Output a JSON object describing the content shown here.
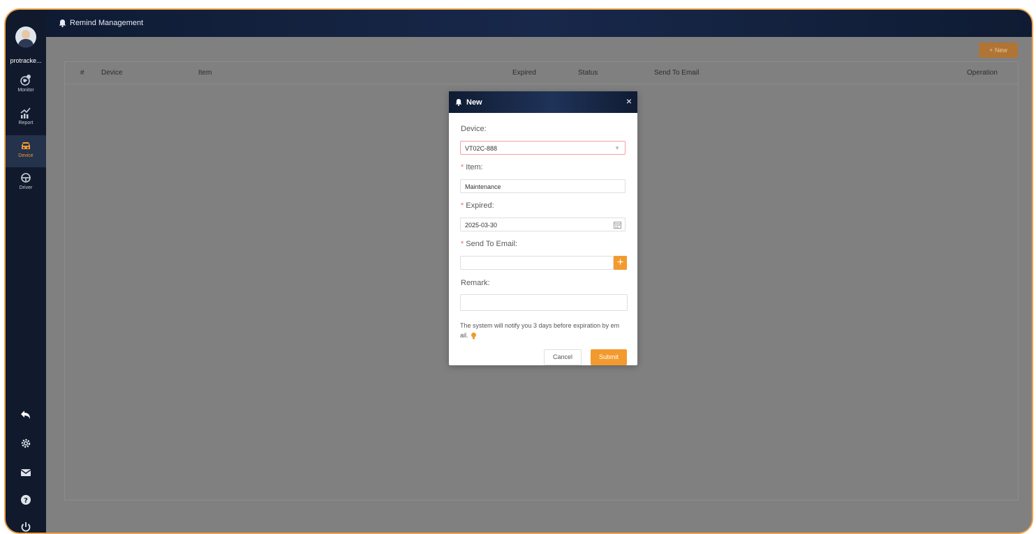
{
  "app": {
    "accent_color": "#f39a2e",
    "sidebar_color": "#101a2c"
  },
  "user": {
    "name": "protracke..."
  },
  "sidebar": {
    "items": [
      {
        "label": "Monitor",
        "icon": "globe-location-icon",
        "active": false
      },
      {
        "label": "Report",
        "icon": "chart-icon",
        "active": false
      },
      {
        "label": "Device",
        "icon": "car-icon",
        "active": true
      },
      {
        "label": "Driver",
        "icon": "steering-wheel-icon",
        "active": false
      }
    ],
    "bottom_icons": [
      "back-icon",
      "settings-icon",
      "mail-icon",
      "help-icon",
      "power-icon"
    ]
  },
  "header": {
    "title": "Remind Management",
    "icon": "bell-icon"
  },
  "toolbar": {
    "new_label": "+ New"
  },
  "table": {
    "columns": [
      "#",
      "Device",
      "Item",
      "Expired",
      "Status",
      "Send To Email",
      "Operation"
    ],
    "rows": []
  },
  "modal": {
    "title": "New",
    "close_label": "×",
    "device_label": "Device:",
    "device_value": "VT02C-888",
    "item_label": "Item:",
    "item_value": "Maintenance",
    "expired_label": "Expired:",
    "expired_value": "2025-03-30",
    "email_label": "Send To Email:",
    "email_value": "",
    "add_email_label": "+",
    "remark_label": "Remark:",
    "remark_value": "",
    "hint": "The system will notify you 3 days before expiration by em ail.",
    "cancel_label": "Cancel",
    "submit_label": "Submit"
  }
}
